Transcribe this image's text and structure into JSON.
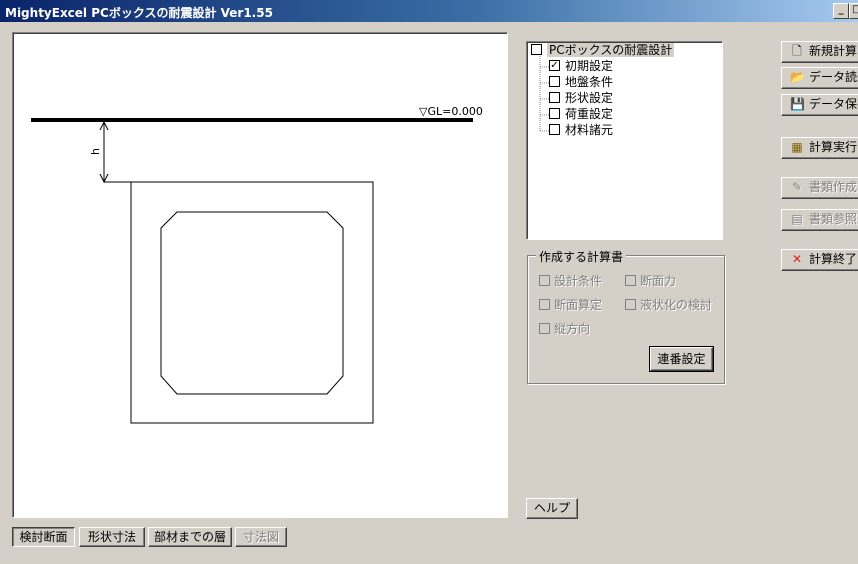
{
  "window": {
    "title": "MightyExcel PCボックスの耐震設計 Ver1.55",
    "minimize": "_",
    "maximize": "□"
  },
  "drawing": {
    "gl_label": "▽GL=0.000",
    "dim_label": "h"
  },
  "tree": {
    "root": {
      "label": "PCボックスの耐震設計",
      "checked": false
    },
    "items": [
      {
        "label": "初期設定",
        "checked": true
      },
      {
        "label": "地盤条件",
        "checked": false
      },
      {
        "label": "形状設定",
        "checked": false
      },
      {
        "label": "荷重設定",
        "checked": false
      },
      {
        "label": "材料諸元",
        "checked": false
      }
    ]
  },
  "reports": {
    "legend": "作成する計算書",
    "options": [
      {
        "label": "設計条件",
        "enabled": false
      },
      {
        "label": "断面力",
        "enabled": false
      },
      {
        "label": "断面算定",
        "enabled": false
      },
      {
        "label": "液状化の検討",
        "enabled": false
      },
      {
        "label": "縦方向",
        "enabled": false
      }
    ],
    "serial_button": "連番設定"
  },
  "help_button": "ヘルプ",
  "bottom_tabs": [
    {
      "label": "検討断面",
      "state": "pressed"
    },
    {
      "label": "形状寸法",
      "state": "normal"
    },
    {
      "label": "部材までの層",
      "state": "normal"
    },
    {
      "label": "寸法図",
      "state": "disabled"
    }
  ],
  "side_buttons": [
    {
      "label": "新規計算",
      "icon": "new-file-icon",
      "glyph": "🗋",
      "enabled": true
    },
    {
      "label": "データ読込",
      "icon": "open-folder-icon",
      "glyph": "📂",
      "enabled": true
    },
    {
      "label": "データ保存",
      "icon": "save-disk-icon",
      "glyph": "💾",
      "enabled": true
    },
    {
      "label": "計算実行",
      "icon": "calculator-icon",
      "glyph": "▦",
      "enabled": true
    },
    {
      "label": "書類作成",
      "icon": "edit-document-icon",
      "glyph": "✎",
      "enabled": false
    },
    {
      "label": "書類参照",
      "icon": "view-document-icon",
      "glyph": "▤",
      "enabled": false
    },
    {
      "label": "計算終了",
      "icon": "close-x-icon",
      "glyph": "✕",
      "enabled": true
    }
  ],
  "colors": {
    "title_gradient_start": "#0a246a",
    "title_gradient_end": "#a6caf0",
    "face": "#d4d0c8",
    "exit_icon": "#e02020"
  }
}
